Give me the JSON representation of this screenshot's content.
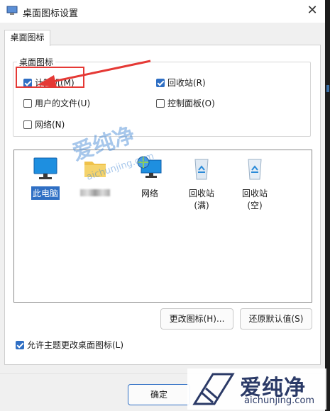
{
  "window": {
    "title": "桌面图标设置"
  },
  "tab": {
    "label": "桌面图标"
  },
  "group": {
    "label": "桌面图标",
    "checkboxes": [
      {
        "label": "计算机(M)",
        "checked": true
      },
      {
        "label": "回收站(R)",
        "checked": true
      },
      {
        "label": "用户的文件(U)",
        "checked": false
      },
      {
        "label": "控制面板(O)",
        "checked": false
      },
      {
        "label": "网络(N)",
        "checked": false
      }
    ]
  },
  "icons": [
    {
      "label": "此电脑",
      "icon": "monitor-icon",
      "selected": true
    },
    {
      "label": "",
      "icon": "folder-icon",
      "selected": false
    },
    {
      "label": "网络",
      "icon": "network-icon",
      "selected": false
    },
    {
      "label": "回收站(满)",
      "icon": "recycle-bin-full-icon",
      "selected": false
    },
    {
      "label": "回收站(空)",
      "icon": "recycle-bin-empty-icon",
      "selected": false
    }
  ],
  "buttons": {
    "change_icon": "更改图标(H)...",
    "restore_default": "还原默认值(S)",
    "ok": "确定"
  },
  "allow_theme": {
    "label": "允许主题更改桌面图标(L)",
    "checked": true
  },
  "watermark": {
    "brand": "爱纯净",
    "url": "aichunjing.com"
  },
  "colors": {
    "accent": "#2f6fc4",
    "annotation": "#e53935"
  }
}
